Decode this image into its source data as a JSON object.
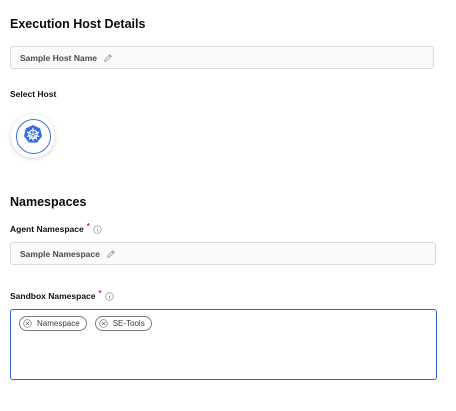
{
  "execution_host": {
    "title": "Execution Host Details",
    "host_name_value": "Sample Host Name",
    "select_host_label": "Select Host",
    "selected_host_icon": "kubernetes-icon"
  },
  "namespaces": {
    "title": "Namespaces",
    "agent": {
      "label": "Agent Namespace",
      "required_marker": "*",
      "value": "Sample Namespace"
    },
    "sandbox": {
      "label": "Sandbox Namespace",
      "required_marker": "*",
      "chips": [
        "Namespace",
        "SE-Tools"
      ]
    }
  },
  "colors": {
    "accent": "#2f64d6",
    "required": "#e0242b",
    "kubernetes": "#326ce5"
  }
}
